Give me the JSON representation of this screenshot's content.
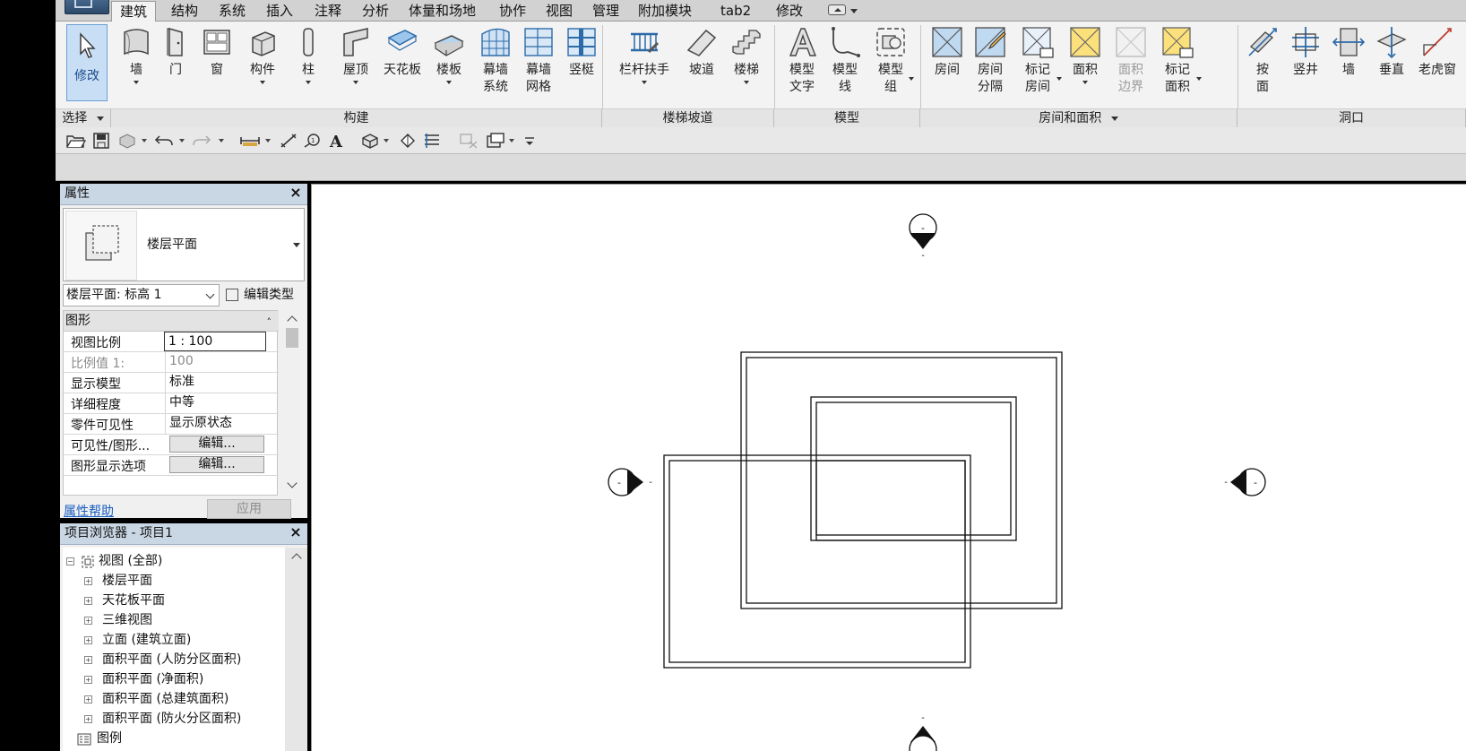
{
  "tabs": [
    "建筑",
    "结构",
    "系统",
    "插入",
    "注释",
    "分析",
    "体量和场地",
    "协作",
    "视图",
    "管理",
    "附加模块",
    "tab2",
    "修改"
  ],
  "active_tab": "建筑",
  "ribbon": {
    "modify_label": "修改",
    "select_label": "选择",
    "build": {
      "label": "构建",
      "wall": "墙",
      "door": "门",
      "window": "窗",
      "component": "构件",
      "column": "柱",
      "roof": "屋顶",
      "ceiling": "天花板",
      "floor": "楼板",
      "curtain_system_1": "幕墙",
      "curtain_system_2": "系统",
      "curtain_grid_1": "幕墙",
      "curtain_grid_2": "网格",
      "mullion": "竖梃"
    },
    "circulation": {
      "label": "楼梯坡道",
      "railing": "栏杆扶手",
      "ramp": "坡道",
      "stair": "楼梯"
    },
    "model": {
      "label": "模型",
      "model_text_1": "模型",
      "model_text_2": "文字",
      "model_line_1": "模型",
      "model_line_2": "线",
      "model_group_1": "模型",
      "model_group_2": "组"
    },
    "room_area": {
      "label": "房间和面积",
      "room": "房间",
      "room_sep_1": "房间",
      "room_sep_2": "分隔",
      "tag_room_1": "标记",
      "tag_room_2": "房间",
      "area": "面积",
      "area_boundary_1": "面积",
      "area_boundary_2": "边界",
      "tag_area_1": "标记",
      "tag_area_2": "面积"
    },
    "opening": {
      "label": "洞口",
      "by_face_1": "按",
      "by_face_2": "面",
      "shaft": "竖井",
      "wall": "墙",
      "vertical": "垂直",
      "dormer": "老虎窗"
    }
  },
  "properties": {
    "title": "属性",
    "type_name": "楼层平面",
    "view_selector": "楼层平面: 标高 1",
    "edit_type": "编辑类型",
    "group": "图形",
    "rows": [
      {
        "key": "视图比例",
        "value": "1 : 100"
      },
      {
        "key": "比例值 1:",
        "value": "100"
      },
      {
        "key": "显示模型",
        "value": "标准"
      },
      {
        "key": "详细程度",
        "value": "中等"
      },
      {
        "key": "零件可见性",
        "value": "显示原状态"
      },
      {
        "key": "可见性/图形...",
        "value": "编辑..."
      },
      {
        "key": "图形显示选项",
        "value": "编辑..."
      }
    ],
    "help": "属性帮助",
    "apply": "应用"
  },
  "browser": {
    "title": "项目浏览器 - 项目1",
    "root": "视图 (全部)",
    "items": [
      "楼层平面",
      "天花板平面",
      "三维视图",
      "立面 (建筑立面)",
      "面积平面 (人防分区面积)",
      "面积平面 (净面积)",
      "面积平面 (总建筑面积)",
      "面积平面 (防火分区面积)"
    ],
    "legend": "图例"
  },
  "canvas": {
    "elevation_marker_text": "-"
  },
  "colors": {
    "ribbon_bg": "#f3f3f3",
    "panel_title_bg": "#e4e4e4",
    "active_button": "#c8def4",
    "title_bar": "#c9d6e4",
    "link": "#1a5ec0"
  }
}
